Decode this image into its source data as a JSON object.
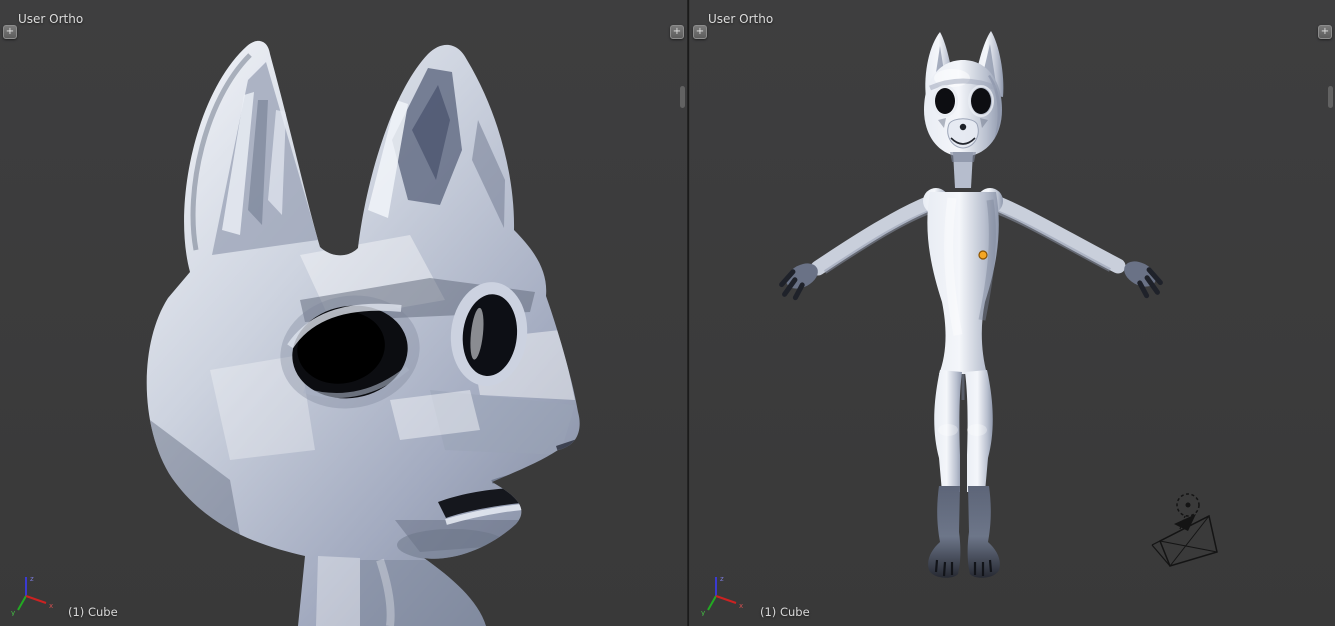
{
  "viewports": [
    {
      "title": "User Ortho",
      "status": "(1) Cube"
    },
    {
      "title": "User Ortho",
      "status": "(1) Cube"
    }
  ],
  "corner_button_label": "+",
  "axis_labels": {
    "x": "x",
    "y": "y",
    "z": "z"
  },
  "icons": {
    "region_plus": "plus-icon",
    "axis_gizmo": "axis-gizmo-icon",
    "camera": "camera-wireframe-icon",
    "lamp": "lamp-dashed-circle-icon"
  },
  "colors": {
    "viewport_bg": "#3c3c3c",
    "divider": "#151515",
    "label_text": "#dcdcdc",
    "axis_x": "#cc2222",
    "axis_y": "#22aa22",
    "axis_z": "#3a3ad0",
    "origin_dot": "#f5a623",
    "model_light": "#f4f6fa",
    "model_mid": "#c3c9d6",
    "model_shadow": "#7d8699",
    "feature_dark": "#0d0e12",
    "object_icon": "#141414"
  }
}
